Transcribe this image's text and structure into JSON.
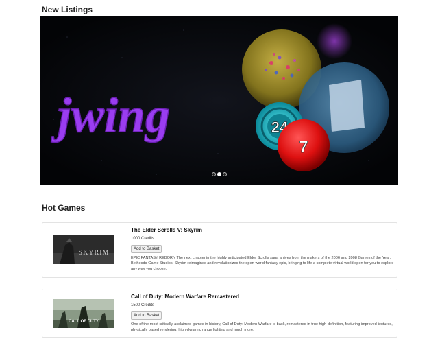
{
  "sections": {
    "new_listings": "New Listings",
    "hot_games": "Hot Games"
  },
  "banner": {
    "logo_text": "jwing",
    "ball_teal_number": "24",
    "ball_red_number": "7",
    "slide_count": 3,
    "active_slide_index": 1
  },
  "games": [
    {
      "title": "The Elder Scrolls V: Skyrim",
      "price": "1000 Credits",
      "button": "Add to Basket",
      "cover_text": "SKYRIM",
      "description": "EPIC FANTASY REBORN The next chapter in the highly anticipated Elder Scrolls saga arrives from the makers of the 2006 and 2008 Games of the Year, Bethesda Game Studios. Skyrim reimagines and revolutionizes the open-world fantasy epic, bringing to life a complete virtual world open for you to explore any way you choose."
    },
    {
      "title": "Call of Duty: Modern Warfare Remastered",
      "price": "1500 Credits",
      "button": "Add to Basket",
      "cover_text": "CALL OF DUTY",
      "description": "One of the most critically-acclaimed games in history, Call of Duty: Modern Warfare is back, remastered in true high-definition, featuring improved textures, physically based rendering, high-dynamic range lighting and much more."
    }
  ]
}
